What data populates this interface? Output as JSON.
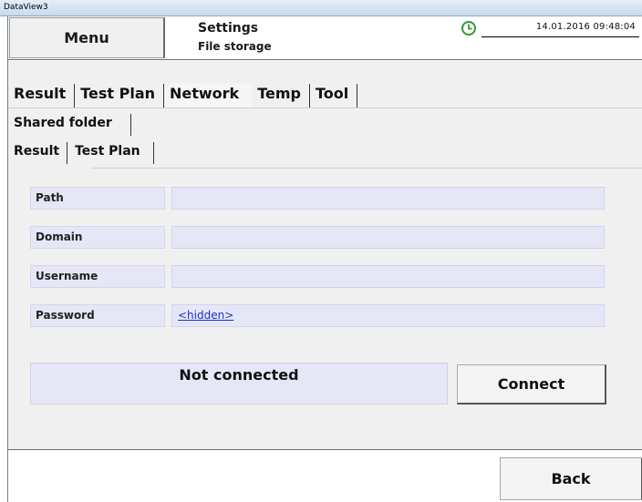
{
  "window": {
    "title": "DataView3"
  },
  "header": {
    "menu_label": "Menu",
    "title": "Settings",
    "subtitle": "File storage",
    "datetime": "14.01.2016  09:48:04",
    "clock_icon": "clock-icon",
    "clock_color": "#2e9a2e"
  },
  "tabs_main": [
    {
      "label": "Result",
      "active": false
    },
    {
      "label": "Test Plan",
      "active": false
    },
    {
      "label": "Network",
      "active": true
    },
    {
      "label": "Temp",
      "active": false
    },
    {
      "label": "Tool",
      "active": false
    }
  ],
  "tabs_network": [
    {
      "label": "Shared folder",
      "active": true
    }
  ],
  "tabs_sub": [
    {
      "label": "Result",
      "active": true
    },
    {
      "label": "Test Plan",
      "active": false
    }
  ],
  "form": {
    "path_label": "Path",
    "path_value": "",
    "domain_label": "Domain",
    "domain_value": "",
    "username_label": "Username",
    "username_value": "",
    "password_label": "Password",
    "password_value": "<hidden>"
  },
  "status": {
    "text": "Not connected"
  },
  "buttons": {
    "connect": "Connect",
    "back": "Back"
  },
  "colors": {
    "field_bg": "#e5e7f7",
    "link": "#1a32c8"
  }
}
